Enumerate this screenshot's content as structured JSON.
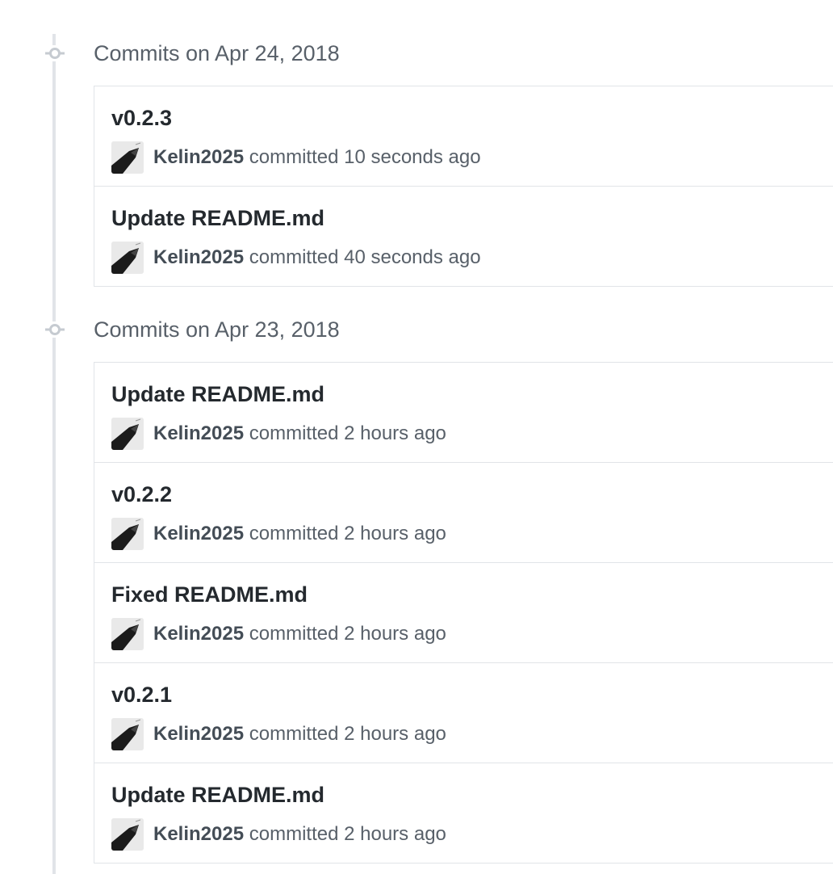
{
  "groups": [
    {
      "title": "Commits on Apr 24, 2018",
      "commits": [
        {
          "title": "v0.2.3",
          "author": "Kelin2025",
          "verb": "committed",
          "time": "10 seconds ago"
        },
        {
          "title": "Update README.md",
          "author": "Kelin2025",
          "verb": "committed",
          "time": "40 seconds ago"
        }
      ]
    },
    {
      "title": "Commits on Apr 23, 2018",
      "commits": [
        {
          "title": "Update README.md",
          "author": "Kelin2025",
          "verb": "committed",
          "time": "2 hours ago"
        },
        {
          "title": "v0.2.2",
          "author": "Kelin2025",
          "verb": "committed",
          "time": "2 hours ago"
        },
        {
          "title": "Fixed README.md",
          "author": "Kelin2025",
          "verb": "committed",
          "time": "2 hours ago"
        },
        {
          "title": "v0.2.1",
          "author": "Kelin2025",
          "verb": "committed",
          "time": "2 hours ago"
        },
        {
          "title": "Update README.md",
          "author": "Kelin2025",
          "verb": "committed",
          "time": "2 hours ago"
        }
      ]
    }
  ],
  "icons": {
    "timeline_node": "git-commit-icon",
    "avatar": "user-avatar"
  },
  "colors": {
    "title_text": "#24292e",
    "muted_text": "#586069",
    "border": "#e1e4e8",
    "timeline": "#e1e4e8"
  }
}
